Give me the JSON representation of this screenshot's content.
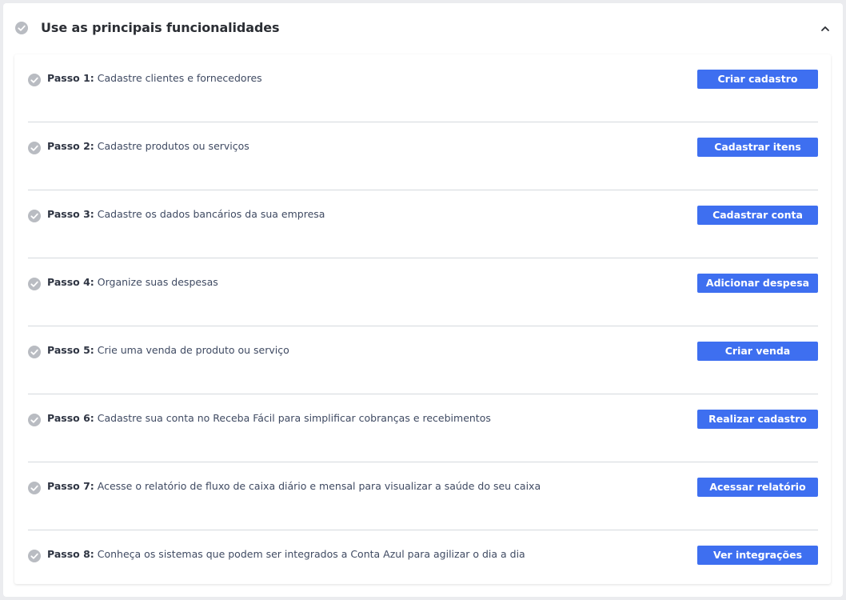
{
  "section": {
    "title": "Use as principais funcionalidades",
    "collapse_icon": "chevron-up-icon",
    "check_icon": "check-circle-icon"
  },
  "colors": {
    "accent": "#3e6ff0",
    "check_gray": "#b9bcc2",
    "divider": "#d5d8dd"
  },
  "steps": [
    {
      "prefix": "Passo 1:",
      "text": " Cadastre clientes e fornecedores",
      "button": "Criar cadastro"
    },
    {
      "prefix": "Passo 2:",
      "text": " Cadastre produtos ou serviços",
      "button": "Cadastrar itens"
    },
    {
      "prefix": "Passo 3:",
      "text": " Cadastre os dados bancários da sua empresa",
      "button": "Cadastrar conta"
    },
    {
      "prefix": "Passo 4:",
      "text": " Organize suas despesas",
      "button": "Adicionar despesa"
    },
    {
      "prefix": "Passo 5:",
      "text": " Crie uma venda de produto ou serviço",
      "button": "Criar venda"
    },
    {
      "prefix": "Passo 6:",
      "text": " Cadastre sua conta no Receba Fácil para simplificar cobranças e recebimentos",
      "button": "Realizar cadastro"
    },
    {
      "prefix": "Passo 7:",
      "text": " Acesse o relatório de fluxo de caixa diário e mensal para visualizar a saúde do seu caixa",
      "button": "Acessar relatório"
    },
    {
      "prefix": "Passo 8:",
      "text": " Conheça os sistemas que podem ser integrados a Conta Azul para agilizar o dia a dia",
      "button": "Ver integrações"
    }
  ]
}
